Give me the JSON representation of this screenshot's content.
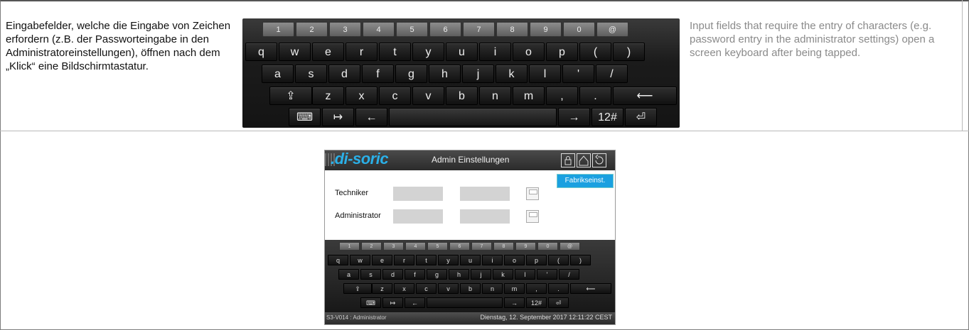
{
  "text_de": "Eingabefelder, welche die Eingabe von Zeichen erfordern (z.B. der Passworteingabe in den Administratoreinstellungen), öffnen nach dem „Klick“ eine Bildschirmtastatur.",
  "text_en": "Input fields that require the entry of characters (e.g. password entry in the administrator settings) open a screen keyboard after being tapped.",
  "keyboard": {
    "num_row": [
      "1",
      "2",
      "3",
      "4",
      "5",
      "6",
      "7",
      "8",
      "9",
      "0",
      "@"
    ],
    "row1": [
      "q",
      "w",
      "e",
      "r",
      "t",
      "y",
      "u",
      "i",
      "o",
      "p",
      "(",
      ")"
    ],
    "row2": [
      "a",
      "s",
      "d",
      "f",
      "g",
      "h",
      "j",
      "k",
      "l",
      "'",
      "/"
    ],
    "row3": [
      "⇪",
      "z",
      "x",
      "c",
      "v",
      "b",
      "n",
      "m",
      ",",
      ".",
      "⟵"
    ],
    "row4": {
      "keyboard_icon": "⌨",
      "tab": "↦",
      "left": "←",
      "right": "→",
      "mode": "12#",
      "enter": "⏎"
    }
  },
  "device": {
    "logo": ".di-soric",
    "title": "Admin Einstellungen",
    "rows": [
      {
        "label": "Techniker"
      },
      {
        "label": "Administrator"
      }
    ],
    "factory_button": "Fabrikseinst.",
    "status_left": "S3-V014 : Administrator",
    "status_right": "Dienstag, 12. September 2017 12:11:22 CEST",
    "header_icons": [
      "lock-icon",
      "home-icon",
      "back-icon"
    ]
  },
  "colors": {
    "accent": "#1aa0e0",
    "logo": "#2ab0e8"
  }
}
